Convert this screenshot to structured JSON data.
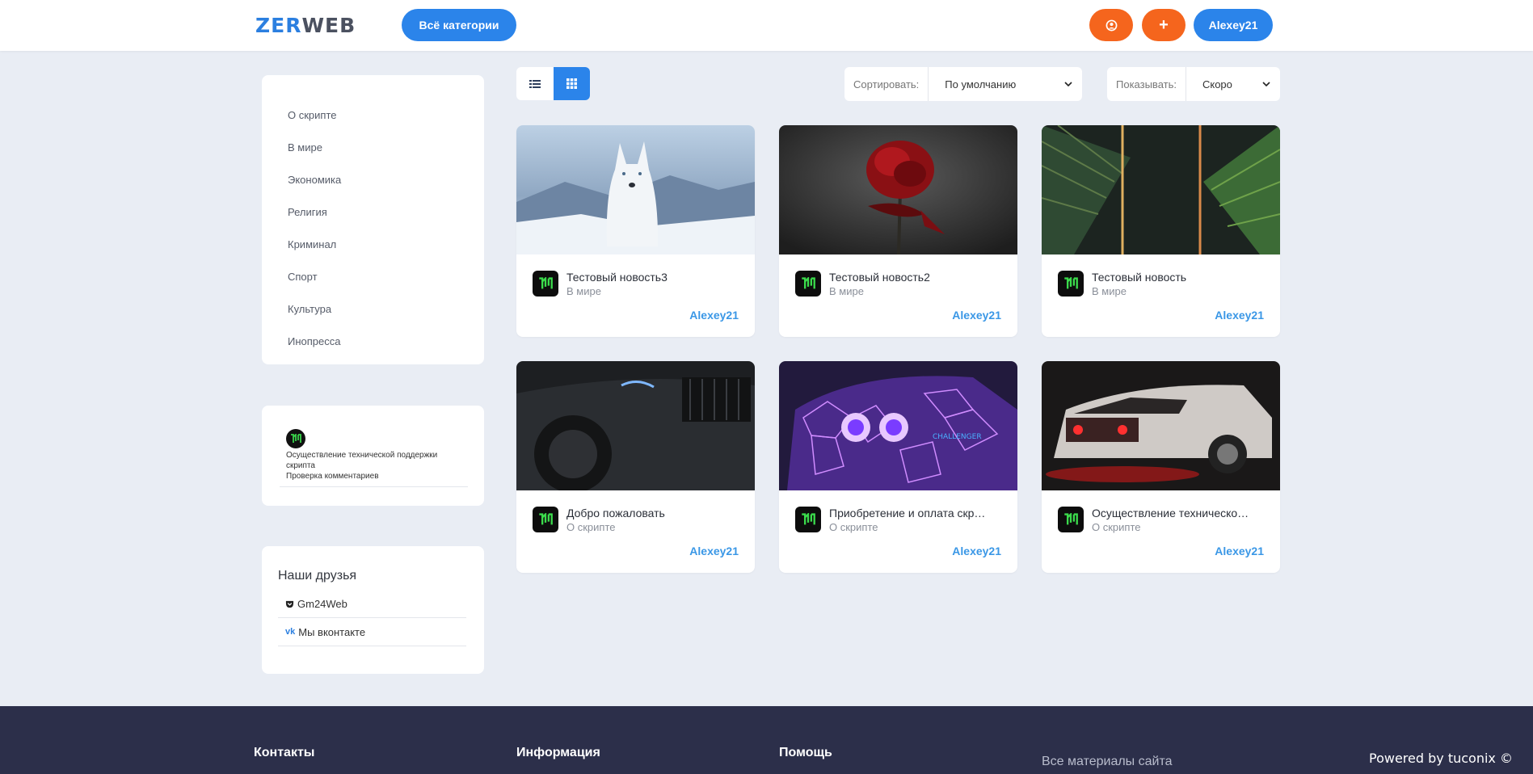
{
  "header": {
    "logo_part1": "ZER",
    "logo_part2": "WEB",
    "categories_button": "Всё категории",
    "user_button": "Alexey21",
    "add_button_glyph": "+"
  },
  "sidebar": {
    "categories": [
      {
        "label": "О скрипте"
      },
      {
        "label": "В мире"
      },
      {
        "label": "Экономика"
      },
      {
        "label": "Религия"
      },
      {
        "label": "Криминал"
      },
      {
        "label": "Спорт"
      },
      {
        "label": "Культура"
      },
      {
        "label": "Инопресса"
      }
    ],
    "comment": {
      "text_line1": "Осуществление технической поддержки скрипта",
      "text_line2": "Проверка комментариев"
    },
    "friends": {
      "title": "Наши друзья",
      "items": [
        {
          "label": "Gm24Web",
          "icon": "pocket-icon"
        },
        {
          "label": "Мы вконтакте",
          "icon": "vk-icon"
        }
      ]
    }
  },
  "toolbar": {
    "sort_label": "Сортировать:",
    "sort_value": "По умолчанию",
    "show_label": "Показывать:",
    "show_value": "Скоро"
  },
  "posts": [
    {
      "title": "Тестовый новость3",
      "category": "В мире",
      "author": "Alexey21",
      "image": "white husky in snowy mountains"
    },
    {
      "title": "Тестовый новость2",
      "category": "В мире",
      "author": "Alexey21",
      "image": "red rose on dark background"
    },
    {
      "title": "Тестовый новость",
      "category": "В мире",
      "author": "Alexey21",
      "image": "palm leaves with neon light"
    },
    {
      "title": "Добро пожаловать",
      "category": "О скрипте",
      "author": "Alexey21",
      "image": "dark car front with blue headlights"
    },
    {
      "title": "Приобретение и оплата скр…",
      "category": "О скрипте",
      "author": "Alexey21",
      "image": "neon challenger car"
    },
    {
      "title": "Осуществление техническо…",
      "category": "О скрипте",
      "author": "Alexey21",
      "image": "white car with red lights"
    }
  ],
  "footer": {
    "contacts": "Контакты",
    "info": "Информация",
    "help": "Помощь",
    "note": "Все материалы сайта",
    "powered": "Powered by tuconix ©"
  },
  "colors": {
    "accent_blue": "#2b84ea",
    "accent_orange": "#f5651d",
    "page_bg": "#e9edf4",
    "footer_bg": "#2c2f4a",
    "author_blue": "#3a97e6"
  }
}
